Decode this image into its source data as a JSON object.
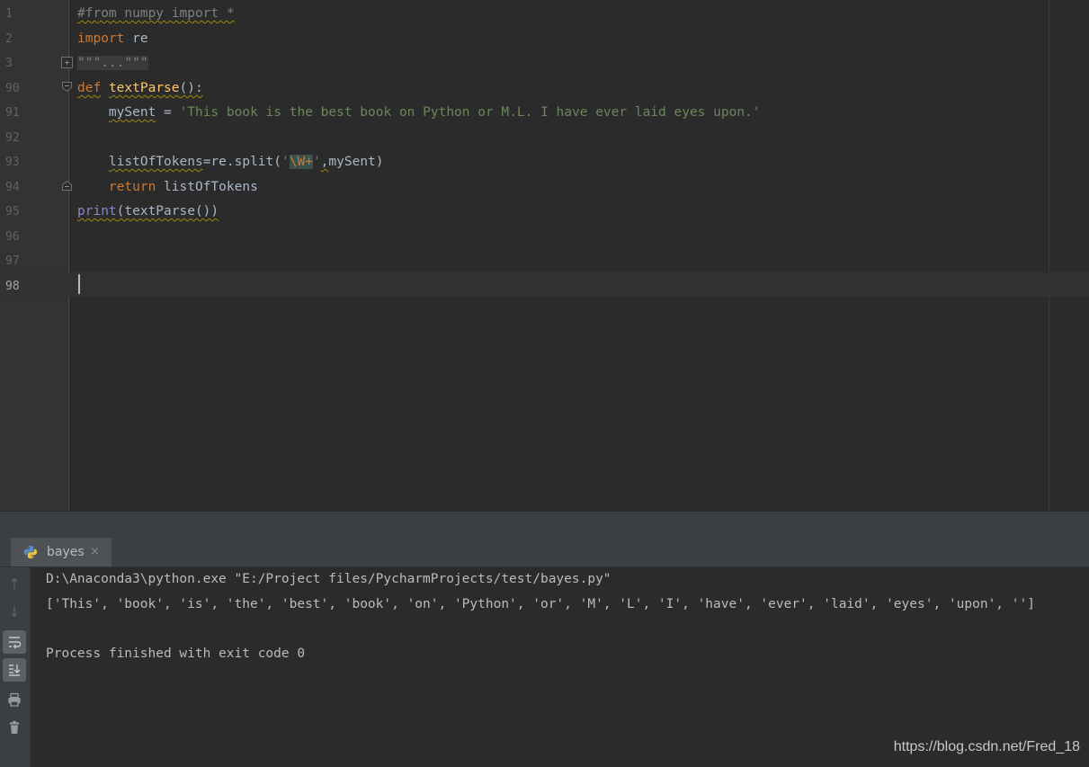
{
  "editor": {
    "line_numbers": [
      "1",
      "2",
      "3",
      "90",
      "91",
      "92",
      "93",
      "94",
      "95",
      "96",
      "97",
      "98"
    ],
    "current_line": "98",
    "code": {
      "l1": "#from numpy import *",
      "l2_kw": "import",
      "l2_rest": " re",
      "l3_fold": "\"\"\"...\"\"\"",
      "l90_kw": "def",
      "l90_name": "textParse",
      "l90_rest": "():",
      "l91_indent": "    ",
      "l91_var": "mySent",
      "l91_eq": " = ",
      "l91_str": "'This book is the best book on Python or M.L. I have ever laid eyes upon.'",
      "l93_indent": "    ",
      "l93_var": "listOfTokens",
      "l93_mid": "=re.split(",
      "l93_q1": "'",
      "l93_esc": "\\W+",
      "l93_q2": "'",
      "l93_comma": ",",
      "l93_rest": "mySent)",
      "l94_indent": "    ",
      "l94_kw": "return",
      "l94_rest": " listOfTokens",
      "l95_builtin": "print",
      "l95_rest": "(textParse())"
    },
    "fold_plus_icon": "plus",
    "fold_minus_icon": "minus"
  },
  "run_panel": {
    "tab_label": "bayes",
    "tab_icon": "python-icon",
    "tab_close": "×",
    "toolbar": {
      "up": "↑",
      "down": "↓",
      "wrap": "⮐",
      "scroll_end": "⤓",
      "print": "⎙",
      "trash": "🗑"
    },
    "console_lines": [
      "D:\\Anaconda3\\python.exe \"E:/Project files/PycharmProjects/test/bayes.py\"",
      "['This', 'book', 'is', 'the', 'best', 'book', 'on', 'Python', 'or', 'M', 'L', 'I', 'have', 'ever', 'laid', 'eyes', 'upon', '']",
      "",
      "Process finished with exit code 0"
    ]
  },
  "watermark": "https://blog.csdn.net/Fred_18",
  "colors": {
    "background": "#2b2b2b",
    "keyword": "#cc7832",
    "string": "#6a8759",
    "function": "#ffc66d",
    "comment": "#808080"
  }
}
